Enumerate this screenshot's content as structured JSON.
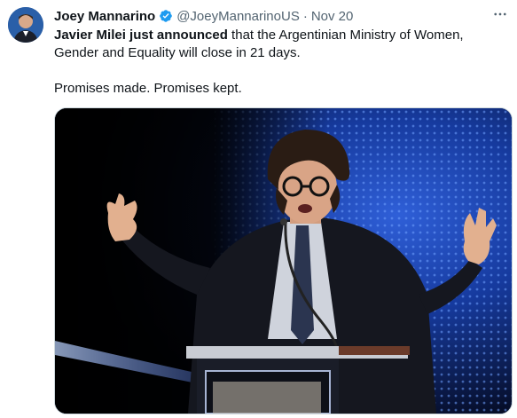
{
  "tweet": {
    "author": {
      "name": "Joey Mannarino",
      "handle": "@JoeyMannarinoUS",
      "verified": true
    },
    "separator": "·",
    "date": "Nov 20",
    "text": {
      "bold_part": "Javier Milei just announced",
      "rest_part": " that the Argentinian Ministry of Women, Gender and Equality will close in 21 days.",
      "second_paragraph": "Promises made. Promises kept."
    },
    "media": {
      "type": "photo"
    },
    "icons": {
      "verified": "verified-badge-icon",
      "more": "more-options-icon"
    }
  },
  "colors": {
    "text": "#0f1419",
    "secondary": "#536471",
    "verified": "#1d9bf0",
    "border": "#cfd9de"
  }
}
